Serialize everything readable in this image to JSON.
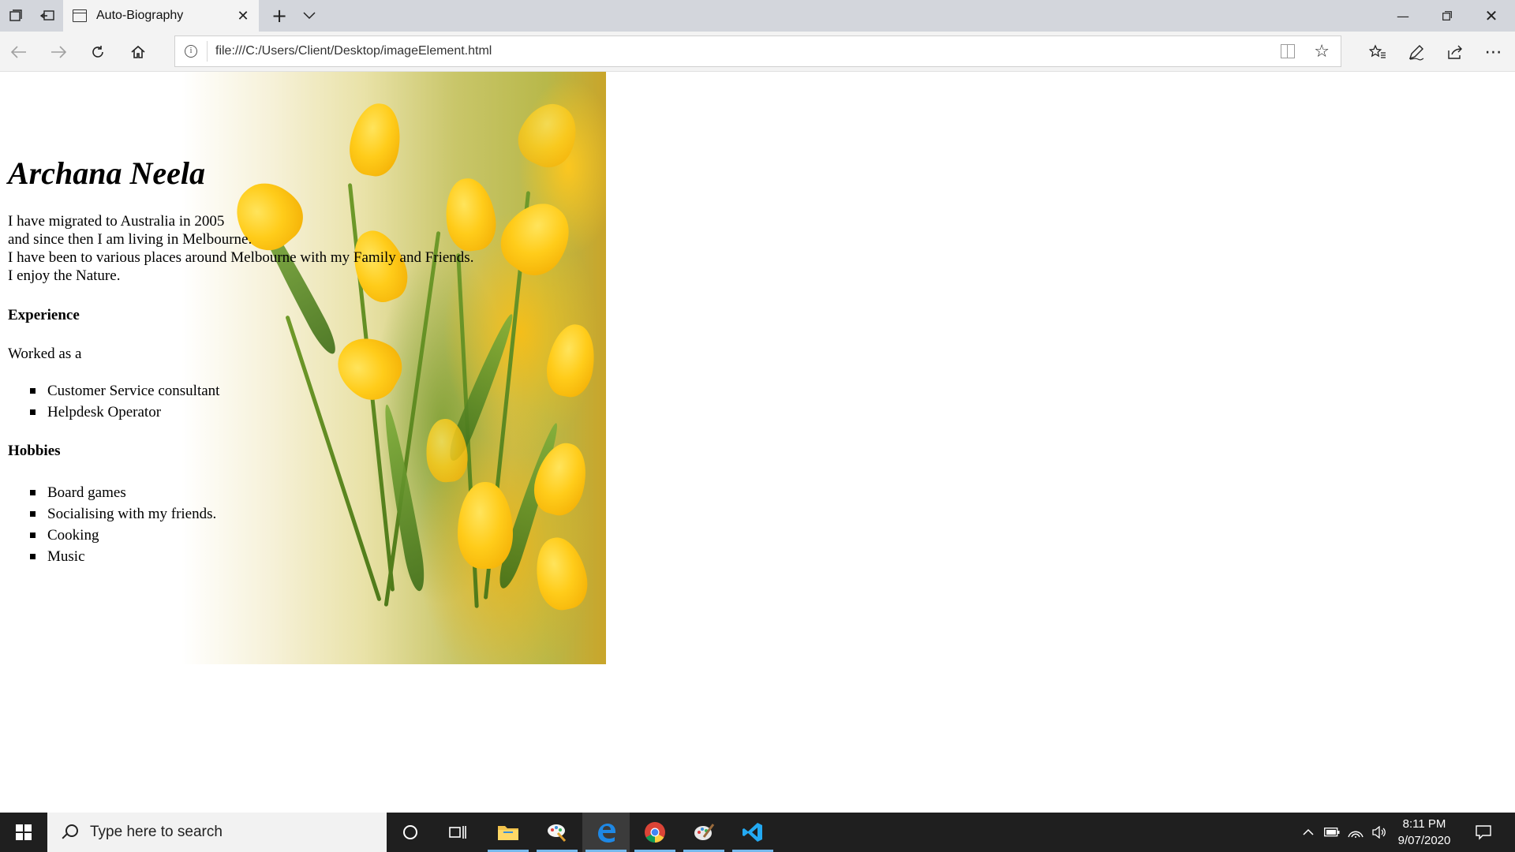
{
  "browser": {
    "tab_title": "Auto-Biography",
    "url": "file:///C:/Users/Client/Desktop/imageElement.html"
  },
  "page": {
    "name": "Archana Neela",
    "bio_lines": [
      "I have migrated to Australia in 2005",
      "and since then I am living in Melbourne.",
      "I have been to various places around Melbourne with my Family and Friends.",
      "I enjoy the Nature."
    ],
    "experience_heading": "Experience",
    "worked_as": "Worked as a",
    "experience_items": [
      "Customer Service consultant",
      "Helpdesk Operator"
    ],
    "hobbies_heading": "Hobbies",
    "hobbies_items": [
      "Board games",
      "Socialising with my friends.",
      "Cooking",
      "Music"
    ]
  },
  "taskbar": {
    "search_placeholder": "Type here to search",
    "time": "8:11 PM",
    "date": "9/07/2020"
  },
  "colors": {
    "tabbar_bg": "#d3d6dc",
    "taskbar_bg": "#1f1f1f",
    "edge_blue": "#0078d7",
    "tulip_yellow": "#ffcc1a"
  }
}
